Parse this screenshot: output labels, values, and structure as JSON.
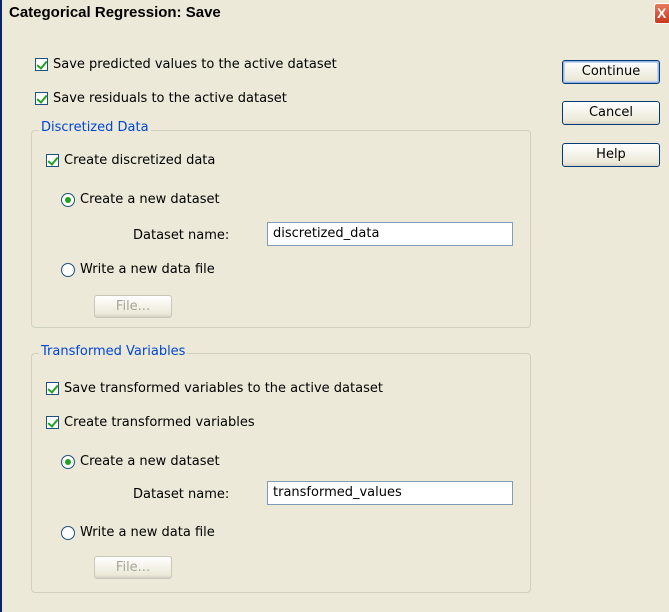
{
  "window": {
    "title": "Categorical Regression: Save",
    "close_glyph": "X"
  },
  "main": {
    "save_predicted_label": "Save predicted values to the active dataset",
    "save_predicted_checked": true,
    "save_residuals_label": "Save residuals to the active dataset",
    "save_residuals_checked": true
  },
  "buttons": {
    "continue": "Continue",
    "cancel": "Cancel",
    "help": "Help"
  },
  "discretized": {
    "legend": "Discretized Data",
    "create_label": "Create discretized data",
    "create_checked": true,
    "new_dataset_label": "Create a new dataset",
    "new_dataset_selected": true,
    "dataset_name_label": "Dataset name:",
    "dataset_name_value": "discretized_data",
    "write_file_label": "Write a new data file",
    "file_button": "File..."
  },
  "transformed": {
    "legend": "Transformed Variables",
    "save_label": "Save transformed variables to the active dataset",
    "save_checked": true,
    "create_label": "Create transformed variables",
    "create_checked": true,
    "new_dataset_label": "Create a new dataset",
    "new_dataset_selected": true,
    "dataset_name_label": "Dataset name:",
    "dataset_name_value": "transformed_values",
    "write_file_label": "Write a new data file",
    "file_button": "File..."
  },
  "colors": {
    "legend": "#0046d5",
    "check": "#21a121",
    "dialog_bg": "#ece9d8"
  }
}
